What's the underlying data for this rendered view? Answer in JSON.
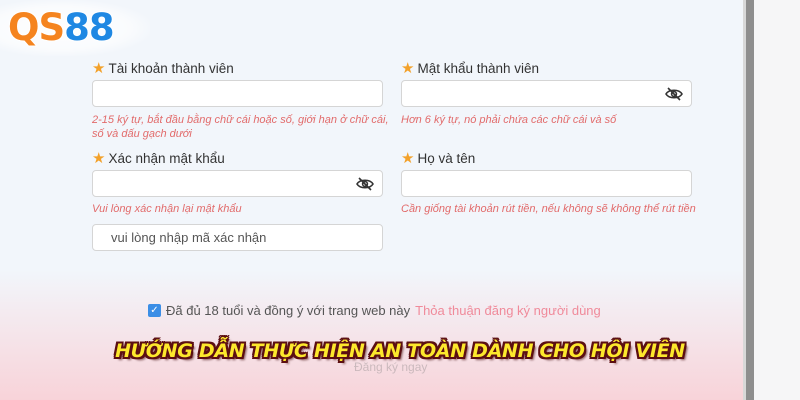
{
  "logo": {
    "part1": "QS",
    "part2": "88"
  },
  "form": {
    "account": {
      "label": "Tài khoản thành viên",
      "hint_line1": "2-15 ký tự, bắt đầu bằng chữ cái hoặc số, giới hạn ở chữ cái,",
      "hint_line2": "số và dấu gạch dưới"
    },
    "password": {
      "label": "Mật khẩu thành viên",
      "hint": "Hơn 6 ký tự, nó phải chứa các chữ cái và số"
    },
    "confirm_password": {
      "label": "Xác nhận mật khẩu",
      "hint": "Vui lòng xác nhận lại mật khẩu"
    },
    "full_name": {
      "label": "Họ và tên",
      "hint": "Cần giống tài khoản rút tiền, nếu không sẽ không thể rút tiền"
    },
    "captcha": {
      "placeholder": "vui lòng nhập mã xác nhận"
    },
    "agreement": {
      "text": "Đã đủ 18 tuổi và đồng ý với trang web này",
      "link": "Thỏa thuận đăng ký người dùng",
      "checked": true
    },
    "faded_text": "Đăng ký ngay"
  },
  "banner": {
    "text": "HƯỚNG DẪN THỰC HIỆN AN TOÀN DÀNH CHO HỘI VIÊN"
  },
  "colors": {
    "logo_orange": "#f5841f",
    "logo_blue": "#1f88e3",
    "star": "#f3a12a",
    "hint_red": "#e26b6b",
    "link_pink": "#f08a9a",
    "banner_yellow": "#fde82c",
    "checkbox_blue": "#3b8ee6"
  }
}
